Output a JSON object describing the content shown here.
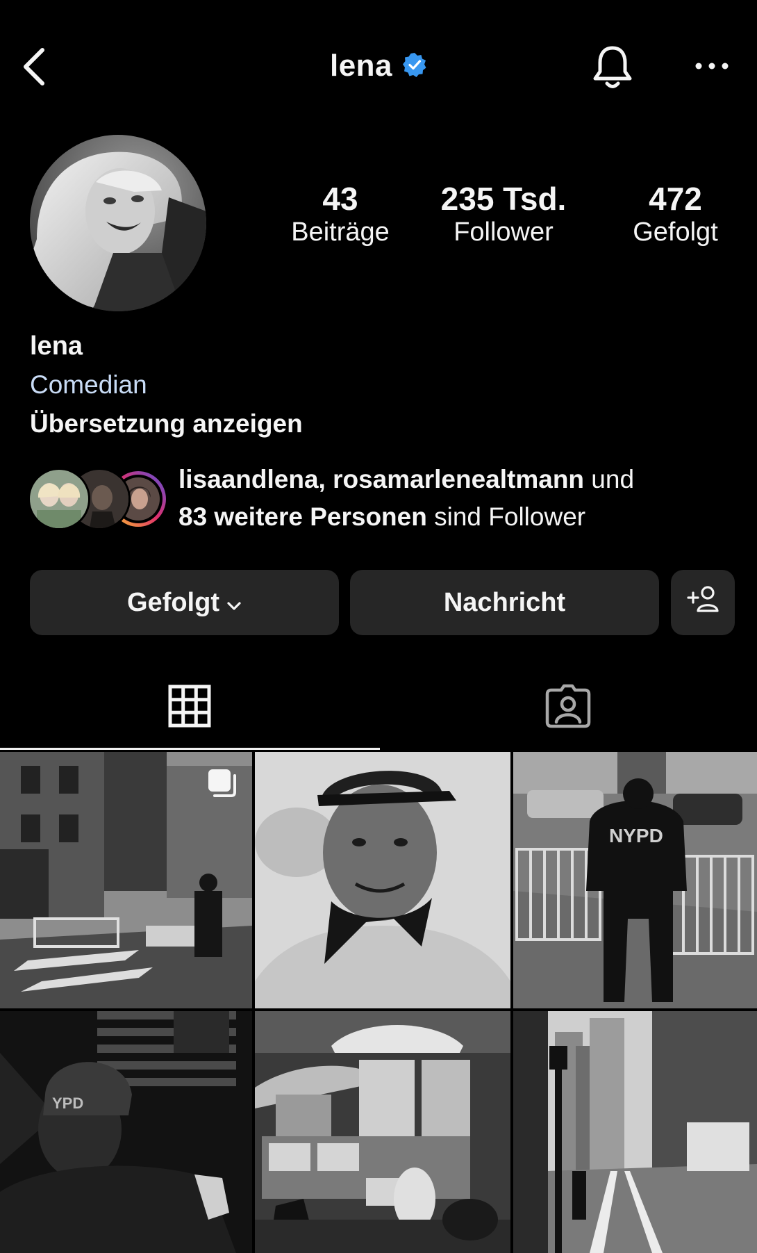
{
  "header": {
    "username": "lena",
    "verified": true,
    "icons": {
      "back": "chevron-left-icon",
      "verified": "verified-badge-icon",
      "notifications": "bell-icon",
      "more": "more-horizontal-icon"
    }
  },
  "stats": {
    "posts": {
      "value": "43",
      "label": "Beiträge"
    },
    "followers": {
      "value": "235 Tsd.",
      "label": "Follower"
    },
    "following": {
      "value": "472",
      "label": "Gefolgt"
    }
  },
  "bio": {
    "name": "lena",
    "category": "Comedian",
    "translate_link": "Übersetzung anzeigen"
  },
  "mutual_followers": {
    "names": "lisaandlena, rosamarlenealtmann",
    "connector": " und",
    "others": "83 weitere Personen",
    "suffix": " sind Follower"
  },
  "actions": {
    "follow_label": "Gefolgt",
    "message_label": "Nachricht",
    "icons": {
      "follow_dropdown": "chevron-down-icon",
      "add_person": "add-person-icon"
    }
  },
  "tabs": [
    {
      "name": "grid",
      "icon": "grid-icon",
      "active": true
    },
    {
      "name": "tagged",
      "icon": "tagged-person-icon",
      "active": false
    }
  ],
  "posts": [
    {
      "subject": "street scene with skateboarder",
      "multi": true
    },
    {
      "subject": "smiling man with cap and bandana",
      "multi": false
    },
    {
      "subject": "NYPD officer at barricade",
      "multi": false
    },
    {
      "subject": "police officer with US flag",
      "multi": false
    },
    {
      "subject": "food cart",
      "multi": false
    },
    {
      "subject": "city street with lamp posts",
      "multi": false
    }
  ],
  "colors": {
    "background": "#000000",
    "button": "#262626",
    "category": "#c9dcf6",
    "verified": "#3897f0"
  }
}
